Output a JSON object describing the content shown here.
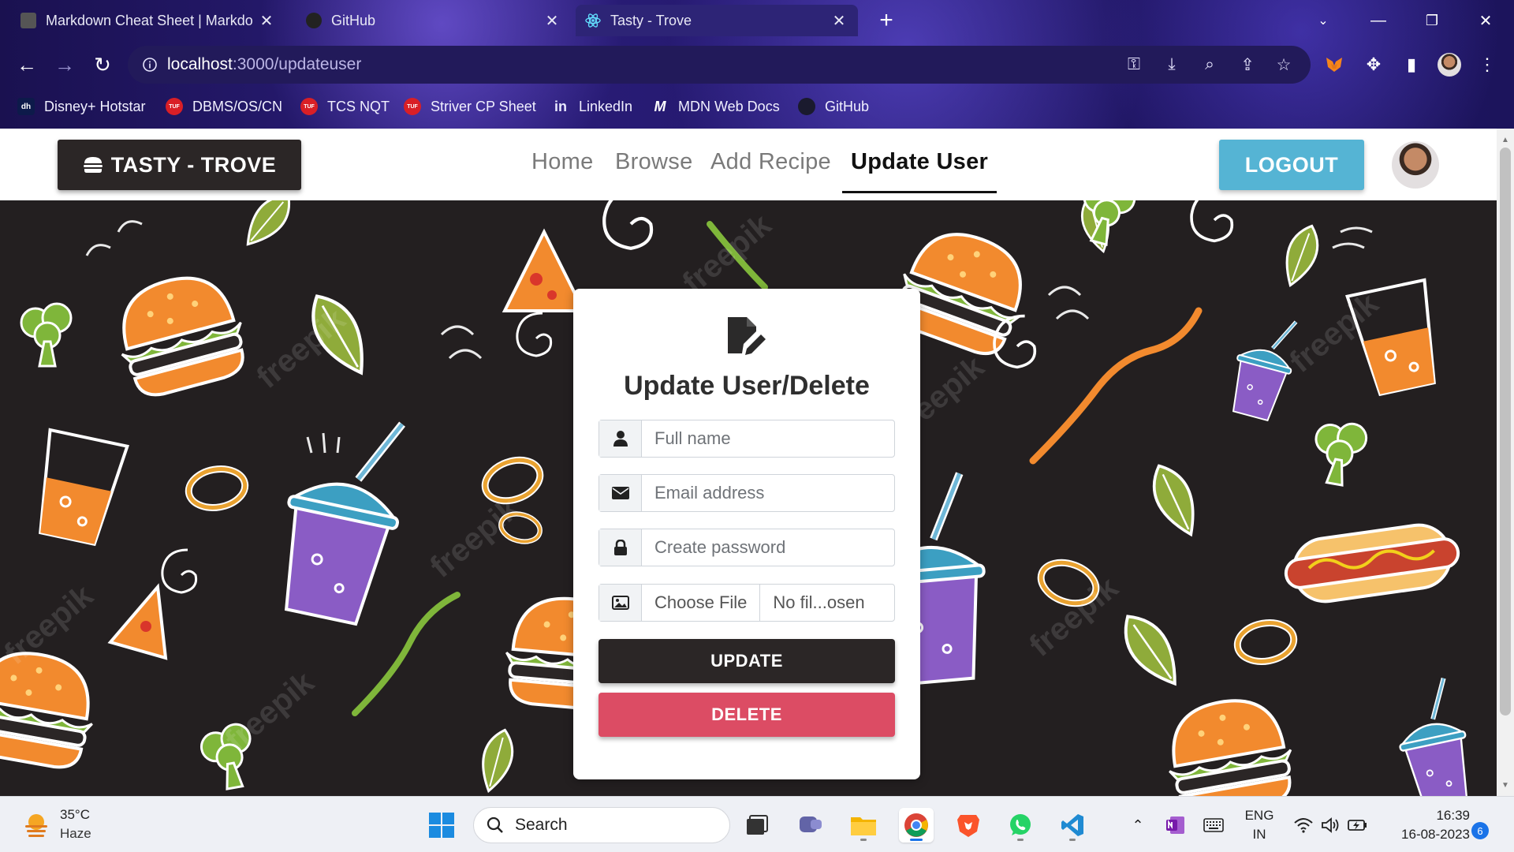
{
  "browser": {
    "tabs": [
      {
        "label": "Markdown Cheat Sheet | Markdo",
        "active": false
      },
      {
        "label": "GitHub",
        "active": false
      },
      {
        "label": "Tasty - Trove",
        "active": true
      }
    ],
    "new_tab_symbol": "+",
    "url_host": "localhost",
    "url_path": ":3000/updateuser",
    "bookmarks": [
      {
        "label": "Disney+ Hotstar",
        "icon": "hotstar-icon",
        "icon_text": "dh"
      },
      {
        "label": "DBMS/OS/CN",
        "icon": "tuf-icon",
        "icon_text": "TUF"
      },
      {
        "label": "TCS NQT",
        "icon": "tuf-icon",
        "icon_text": "TUF"
      },
      {
        "label": "Striver CP Sheet",
        "icon": "tuf-icon",
        "icon_text": "TUF"
      },
      {
        "label": "LinkedIn",
        "icon": "linkedin-icon",
        "icon_text": "in"
      },
      {
        "label": "MDN Web Docs",
        "icon": "mdn-icon",
        "icon_text": "M"
      },
      {
        "label": "GitHub",
        "icon": "github-icon",
        "icon_text": ""
      }
    ]
  },
  "site": {
    "brand": "TASTY - TROVE",
    "nav": [
      {
        "label": "Home",
        "active": false
      },
      {
        "label": "Browse",
        "active": false
      },
      {
        "label": "Add Recipe",
        "active": false
      },
      {
        "label": "Update User",
        "active": true
      }
    ],
    "logout_label": "LOGOUT"
  },
  "form": {
    "title": "Update User/Delete",
    "fullname_placeholder": "Full name",
    "email_placeholder": "Email address",
    "password_placeholder": "Create password",
    "file_button": "Choose File",
    "file_status": "No fil...osen",
    "update_label": "UPDATE",
    "delete_label": "DELETE"
  },
  "watermark": "freepik",
  "taskbar": {
    "weather_temp": "35°C",
    "weather_desc": "Haze",
    "search_placeholder": "Search",
    "lang_line1": "ENG",
    "lang_line2": "IN",
    "time": "16:39",
    "date": "16-08-2023",
    "notification_count": "6"
  },
  "colors": {
    "brand_dark": "#2b2626",
    "logout_blue": "#55b4d4",
    "delete_red": "#dc4c64",
    "hero_bg": "#231f20"
  }
}
